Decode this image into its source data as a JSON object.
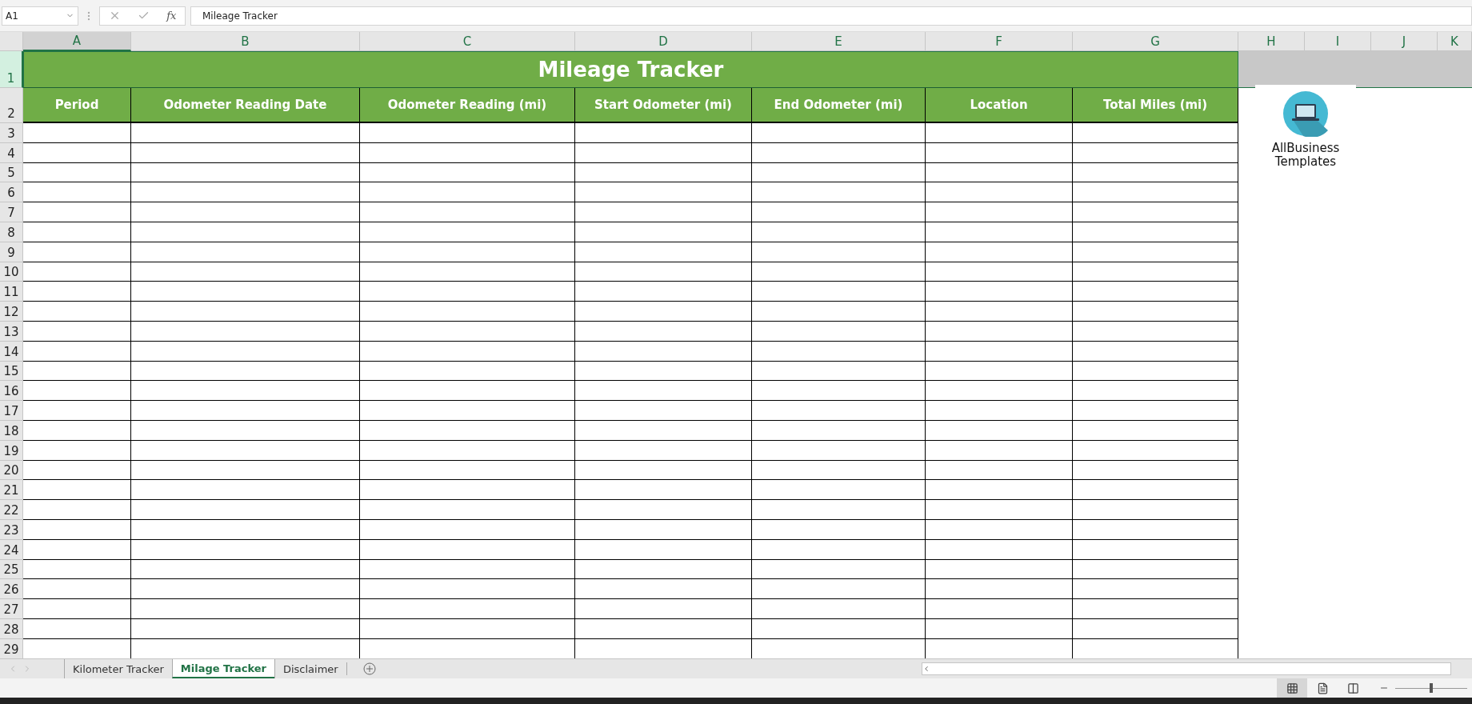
{
  "formula_bar": {
    "name_box": "A1",
    "function_label": "fx",
    "formula": "Mileage Tracker"
  },
  "columns": [
    {
      "letter": "A",
      "selected": true
    },
    {
      "letter": "B",
      "selected": false
    },
    {
      "letter": "C",
      "selected": false
    },
    {
      "letter": "D",
      "selected": false
    },
    {
      "letter": "E",
      "selected": false
    },
    {
      "letter": "F",
      "selected": false
    },
    {
      "letter": "G",
      "selected": false
    },
    {
      "letter": "H",
      "selected": false
    },
    {
      "letter": "I",
      "selected": false
    },
    {
      "letter": "J",
      "selected": false
    },
    {
      "letter": "K",
      "selected": false
    }
  ],
  "title_row": {
    "number": "1",
    "selected": true,
    "title": "Mileage Tracker"
  },
  "header_row": {
    "number": "2",
    "selected": false,
    "headers": [
      "Period",
      "Odometer Reading Date",
      "Odometer Reading (mi)",
      "Start Odometer (mi)",
      "End Odometer (mi)",
      "Location",
      "Total Miles (mi)"
    ]
  },
  "rows": [
    "3",
    "4",
    "5",
    "6",
    "7",
    "8",
    "9",
    "10",
    "11",
    "12",
    "13",
    "14",
    "15",
    "16",
    "17",
    "18",
    "19",
    "20",
    "21",
    "22",
    "23",
    "24",
    "25",
    "26",
    "27",
    "28",
    "29"
  ],
  "logo": {
    "lines": [
      "AllBusiness",
      "Templates"
    ]
  },
  "sheet_tabs": [
    {
      "label": "Kilometer Tracker",
      "selected": false
    },
    {
      "label": "Milage Tracker",
      "selected": true
    },
    {
      "label": "Disclaimer",
      "selected": false
    }
  ],
  "status_bar": {
    "views": [
      {
        "kind": "normal",
        "selected": true
      },
      {
        "kind": "page-layout",
        "selected": false
      },
      {
        "kind": "page-break",
        "selected": false
      }
    ],
    "zoom_slider": {
      "level": 0.5
    }
  }
}
